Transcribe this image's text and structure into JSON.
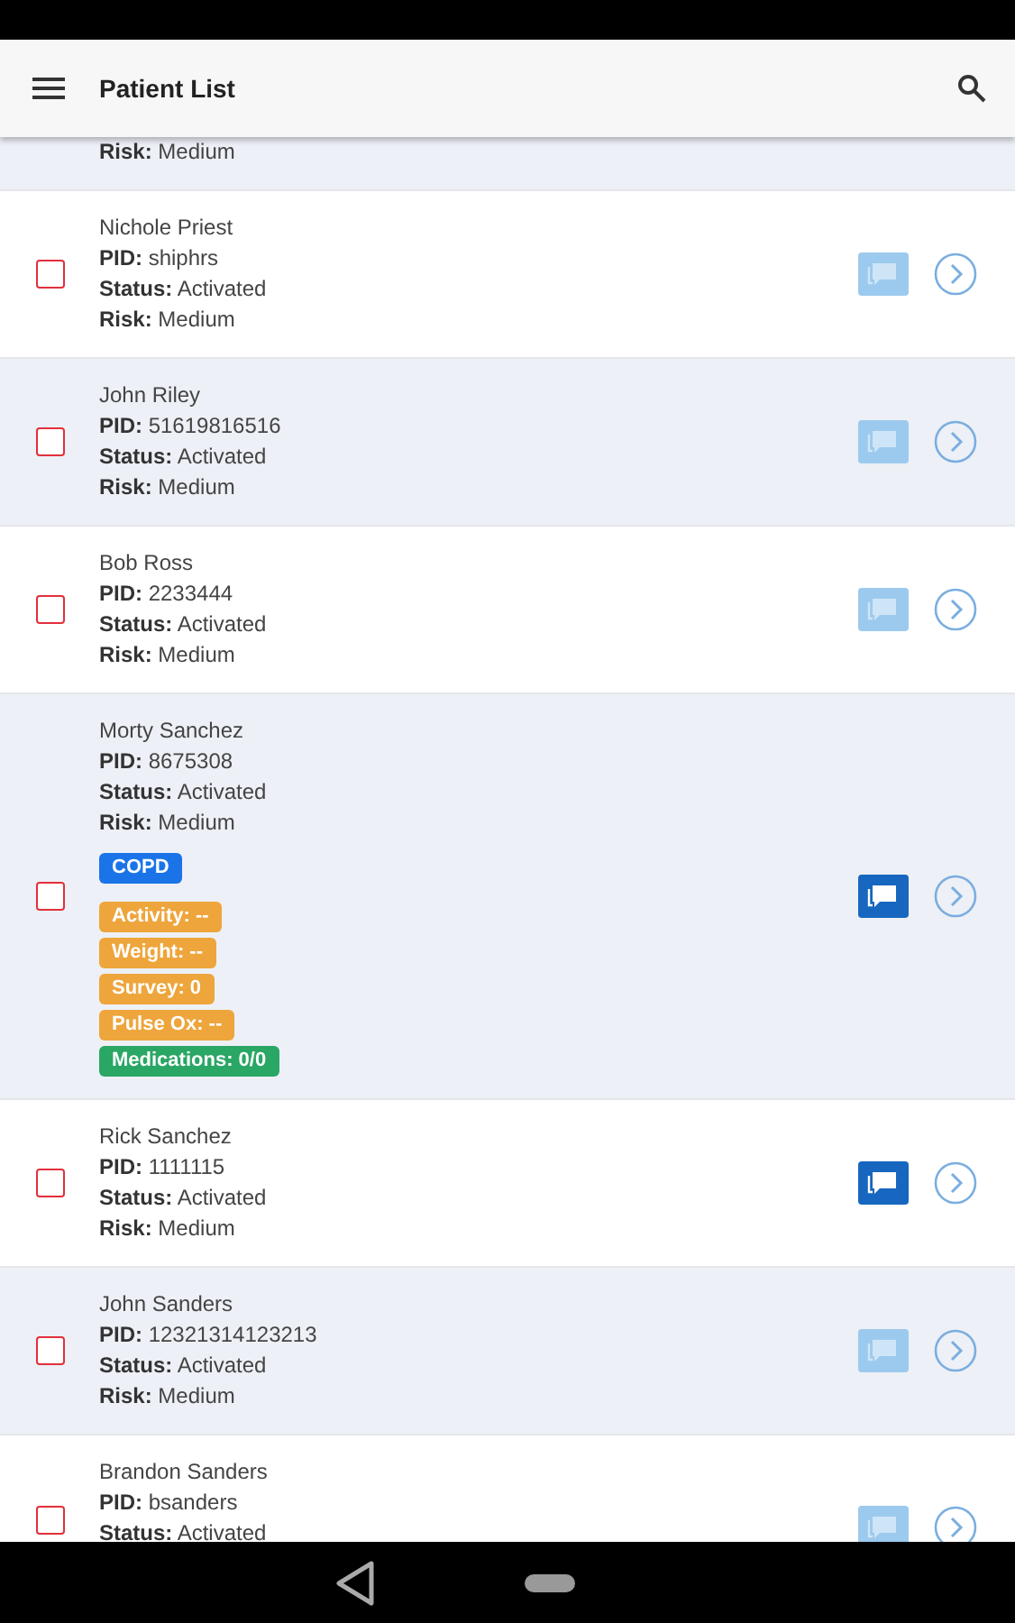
{
  "app_bar": {
    "title": "Patient List"
  },
  "patients": [
    {
      "lines": [
        "**Risk:** Medium"
      ]
    },
    {
      "lines": [
        "Nichole Priest",
        "**PID:** shiphrs",
        "**Status:** Activated",
        "**Risk:** Medium"
      ],
      "checked": false,
      "messages_active": false
    },
    {
      "lines": [
        "John Riley",
        "**PID:** 51619816516",
        "**Status:** Activated",
        "**Risk:** Medium"
      ],
      "checked": false,
      "messages_active": false
    },
    {
      "lines": [
        "Bob Ross",
        "**PID:** 2233444",
        "**Status:** Activated",
        "**Risk:** Medium"
      ],
      "checked": false,
      "messages_active": false
    },
    {
      "lines": [
        "Morty Sanchez",
        "**PID:** 8675308",
        "**Status:** Activated",
        "**Risk:** Medium"
      ],
      "checked": false,
      "messages_active": true,
      "conditions": [
        "COPD"
      ],
      "metrics": [
        {
          "label": "Activity: --",
          "kind": "warning"
        },
        {
          "label": "Weight: --",
          "kind": "warning"
        },
        {
          "label": "Survey: 0",
          "kind": "warning"
        },
        {
          "label": "Pulse Ox: --",
          "kind": "warning"
        },
        {
          "label": "Medications: 0/0",
          "kind": "success"
        }
      ]
    },
    {
      "lines": [
        "Rick Sanchez",
        "**PID:** 1111115",
        "**Status:** Activated",
        "**Risk:** Medium"
      ],
      "checked": false,
      "messages_active": true
    },
    {
      "lines": [
        "John Sanders",
        "**PID:** 12321314123213",
        "**Status:** Activated",
        "**Risk:** Medium"
      ],
      "checked": false,
      "messages_active": false
    },
    {
      "lines": [
        "Brandon Sanders",
        "**PID:** bsanders",
        "**Status:** Activated"
      ],
      "checked": false,
      "messages_active": false
    }
  ]
}
